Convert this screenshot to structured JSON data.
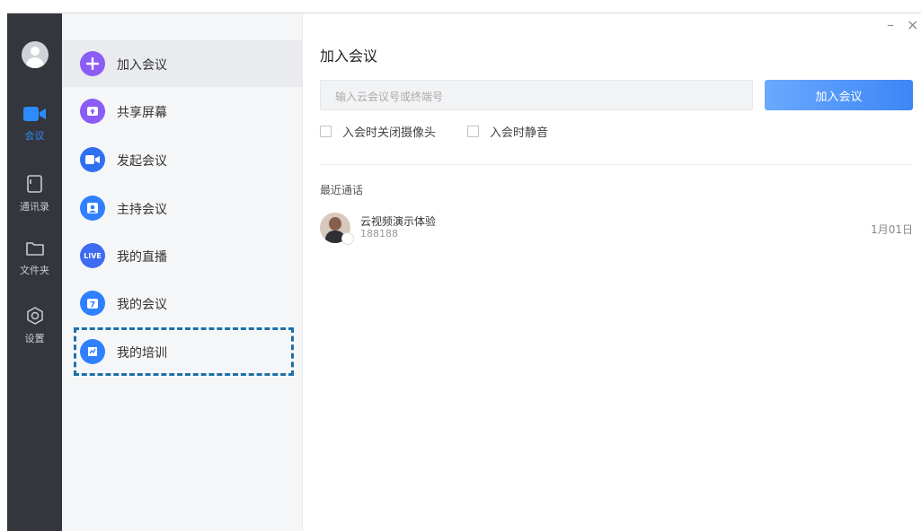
{
  "window": {
    "minimize_label": "–",
    "close_label": "×"
  },
  "rail": {
    "items": [
      {
        "label": "会议",
        "icon": "video-camera-icon"
      },
      {
        "label": "通讯录",
        "icon": "address-book-icon"
      },
      {
        "label": "文件夹",
        "icon": "folder-icon"
      },
      {
        "label": "设置",
        "icon": "settings-hexagon-icon"
      }
    ]
  },
  "menu": {
    "items": [
      {
        "label": "加入会议",
        "icon": "plus-icon",
        "color": "#8b5cf6"
      },
      {
        "label": "共享屏幕",
        "icon": "share-screen-icon",
        "color": "#8b5cf6"
      },
      {
        "label": "发起会议",
        "icon": "video-icon",
        "color": "#2f6ff2"
      },
      {
        "label": "主持会议",
        "icon": "host-icon",
        "color": "#2f80ff"
      },
      {
        "label": "我的直播",
        "icon": "live-icon",
        "color": "#3d6cf0"
      },
      {
        "label": "我的会议",
        "icon": "calendar-icon",
        "color": "#2f80ff"
      },
      {
        "label": "我的培训",
        "icon": "training-icon",
        "color": "#2f80ff"
      }
    ]
  },
  "main": {
    "title": "加入会议",
    "meeting_input": {
      "placeholder": "输入云会议号或终端号"
    },
    "join_button": "加入会议",
    "options": [
      {
        "label": "入会时关闭摄像头"
      },
      {
        "label": "入会时静音"
      }
    ],
    "recent_title": "最近通话",
    "recent": [
      {
        "name": "云视频演示体验",
        "number": "188188",
        "date": "1月01日"
      }
    ]
  },
  "colors": {
    "accent": "#2e8bff",
    "rail_bg": "#34363d",
    "highlight_border": "#1f6fa8"
  }
}
